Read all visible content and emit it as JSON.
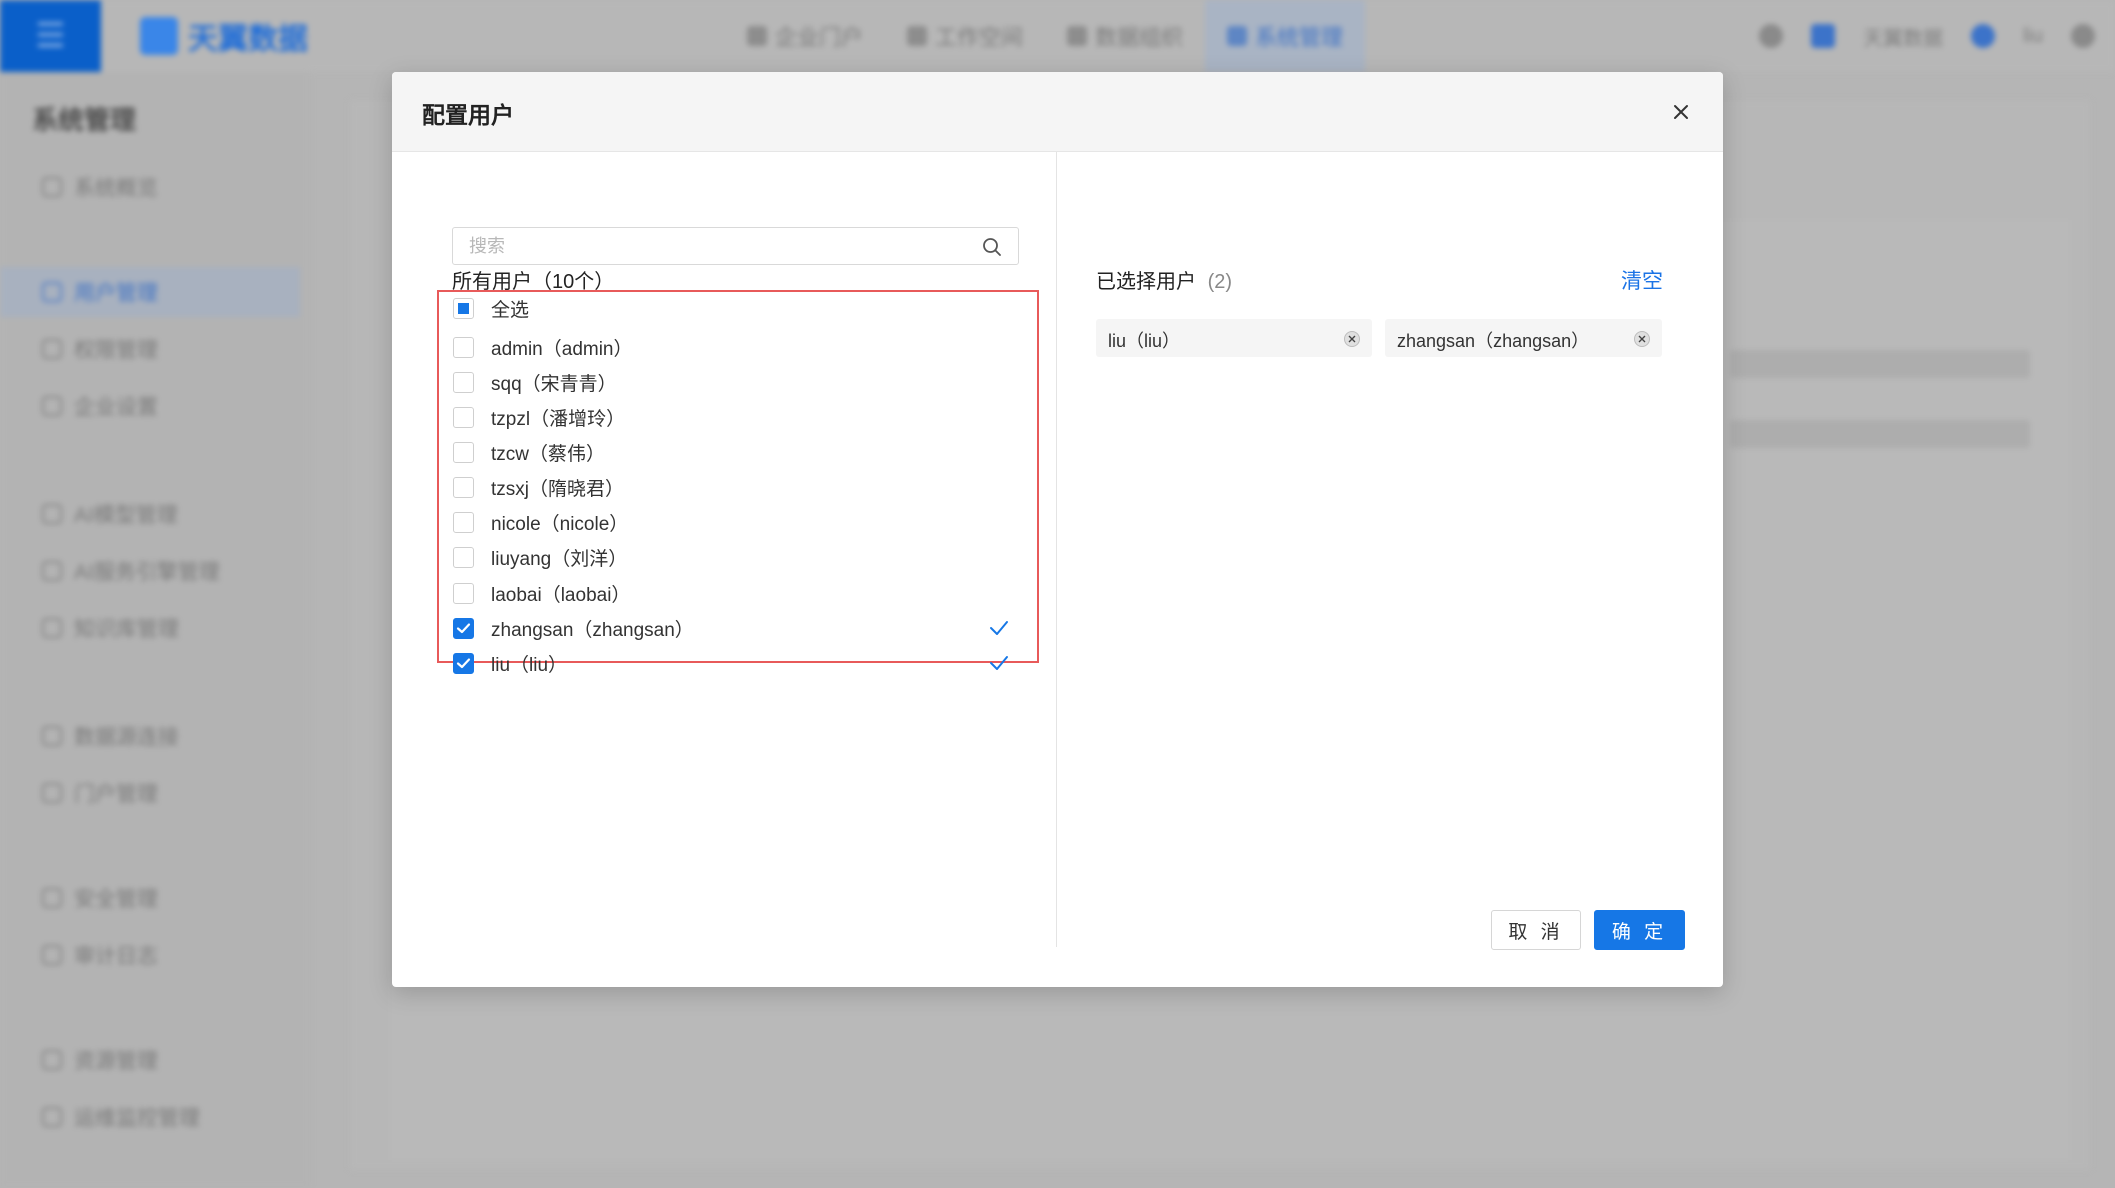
{
  "background": {
    "app_name": "天翼数据",
    "top_nav": [
      {
        "label": "企业门户"
      },
      {
        "label": "工作空间"
      },
      {
        "label": "数据组织"
      },
      {
        "label": "系统管理"
      }
    ],
    "top_right": {
      "workspace": "天翼数据",
      "user": "liu"
    },
    "sidebar": {
      "title": "系统管理",
      "items": [
        {
          "label": "系统概览"
        },
        {
          "label": "用户管理"
        },
        {
          "label": "权限管理"
        },
        {
          "label": "企业设置"
        },
        {
          "label": "AI模型管理"
        },
        {
          "label": "AI服务引擎管理"
        },
        {
          "label": "知识库管理"
        },
        {
          "label": "数据源连接"
        },
        {
          "label": "门户管理"
        },
        {
          "label": "安全管理"
        },
        {
          "label": "审计日志"
        },
        {
          "label": "资源管理"
        },
        {
          "label": "运维监控管理"
        }
      ]
    }
  },
  "modal": {
    "title": "配置用户",
    "left": {
      "title": "所有用户（10个）",
      "search_placeholder": "搜索",
      "select_all": "全选",
      "users": [
        {
          "label": "admin（admin）",
          "checked": false
        },
        {
          "label": "sqq（宋青青）",
          "checked": false
        },
        {
          "label": "tzpzl（潘增玲）",
          "checked": false
        },
        {
          "label": "tzcw（蔡伟）",
          "checked": false
        },
        {
          "label": "tzsxj（隋晓君）",
          "checked": false
        },
        {
          "label": "nicole（nicole）",
          "checked": false
        },
        {
          "label": "liuyang（刘洋）",
          "checked": false
        },
        {
          "label": "laobai（laobai）",
          "checked": false
        },
        {
          "label": "zhangsan（zhangsan）",
          "checked": true
        },
        {
          "label": "liu（liu）",
          "checked": true
        }
      ]
    },
    "right": {
      "title": "已选择用户",
      "count": "(2)",
      "clear_label": "清空",
      "selected": [
        {
          "label": "liu（liu）"
        },
        {
          "label": "zhangsan（zhangsan）"
        }
      ]
    },
    "cancel_label": "取 消",
    "ok_label": "确 定"
  },
  "colors": {
    "accent": "#1677e6",
    "highlight_border": "#e85a5a"
  }
}
